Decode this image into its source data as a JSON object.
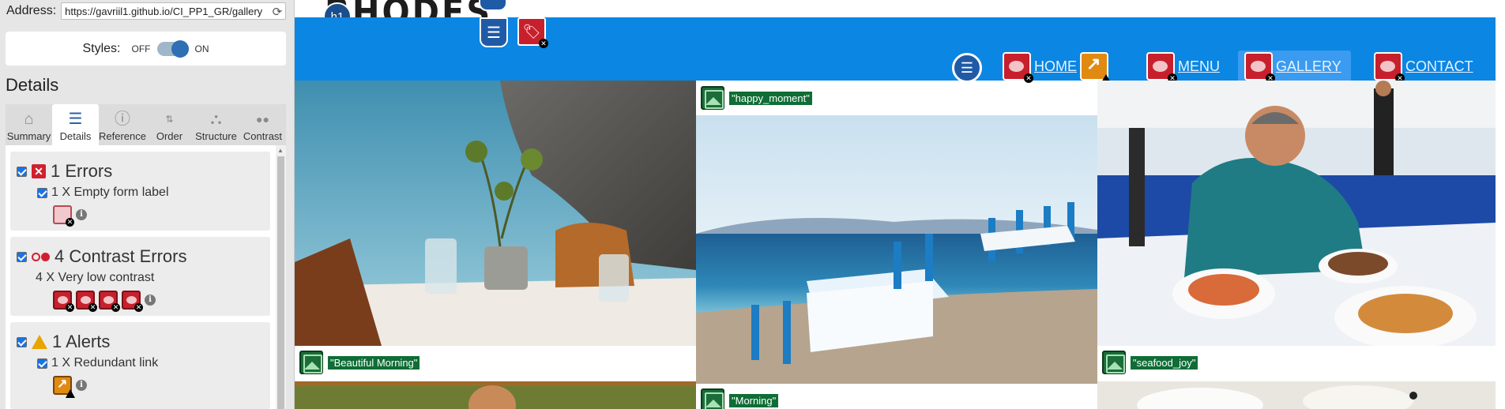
{
  "panel": {
    "address_label": "Address:",
    "address_value": "https://gavriil1.github.io/CI_PP1_GR/gallery",
    "styles_label": "Styles:",
    "styles_off": "OFF",
    "styles_on": "ON",
    "details_heading": "Details",
    "tabs": [
      {
        "label": "Summary",
        "icon": "home-icon"
      },
      {
        "label": "Details",
        "icon": "list-icon"
      },
      {
        "label": "Reference",
        "icon": "info-icon"
      },
      {
        "label": "Order",
        "icon": "order-icon"
      },
      {
        "label": "Structure",
        "icon": "structure-icon"
      },
      {
        "label": "Contrast",
        "icon": "contrast-icon"
      }
    ],
    "errors": {
      "title": "1 Errors",
      "item": "1 X Empty form label"
    },
    "contrast": {
      "title": "4 Contrast Errors",
      "item": "4 X Very low contrast"
    },
    "alerts": {
      "title": "1 Alerts",
      "item": "1 X Redundant link"
    }
  },
  "site": {
    "brand": "RHODES",
    "h1_badge": "h1",
    "nav": {
      "home": "HOME",
      "menu": "MENU",
      "gallery": "GALLERY",
      "contact": "CONTACT"
    },
    "captions": {
      "c1": "\"happy_moment\"",
      "c2": "\"Beautiful Morning\"",
      "c3": "\"seafood_joy\"",
      "c4": "\"Morning\""
    },
    "colors": {
      "navbar": "#0b86e3",
      "wave_error": "#c7202c",
      "wave_alert": "#e08a12",
      "wave_image": "#1b6d3a"
    }
  }
}
